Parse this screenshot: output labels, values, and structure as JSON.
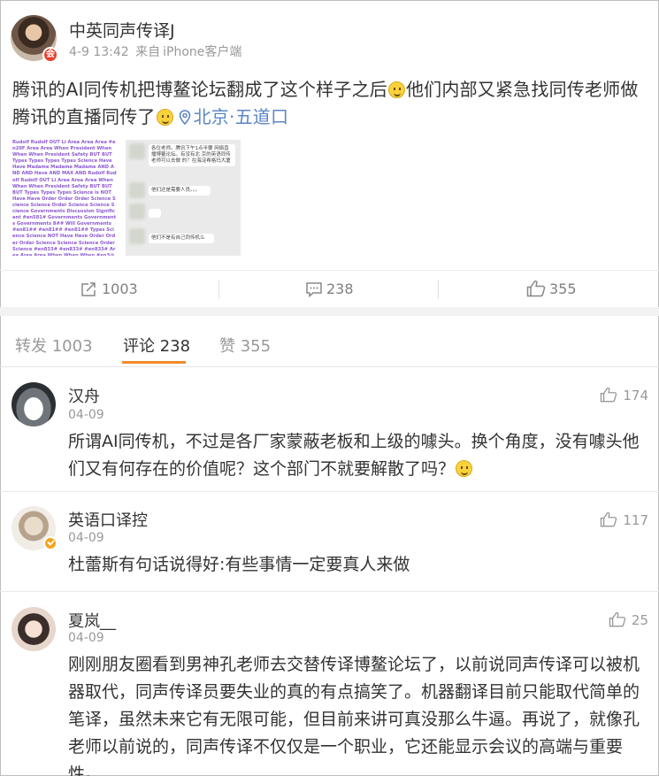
{
  "post": {
    "author": "中英同声传译J",
    "date": "4-9 13:42",
    "source_prefix": "来自",
    "source": "iPhone客户端",
    "text_part1": "腾讯的AI同传机把博鳌论坛翻成了这个样子之后",
    "text_part2": "他们内部又紧急找同传老师做腾讯的直播同传了",
    "location": "北京·五道口",
    "thumb1_text": "Rudolf Rudolf OUT Li Area Area Area #en20F Area Area When President When When When President Safety BUT BUT Types Types Types Types Science Have Have Madame Madame Madame AND AND AND Have AND MAX AND Rudolf Rudolf Rudolf OUT Li Area Area Area When When When President Safety BUT BUT BUT Types Types Types Science is NOT Have Have Order Order Order Science Science Science Order Science Science Science Governments Discussion Significant #en581# Governments Governments Governments 8## Will Governments #en81## #en81## #en81## Types Science Science NOT Have Have Order Order Order Science Science Science Order Science #en833# #en833# #en833# Area Area Area When When When #en3@@.",
    "thumb2_bubble1": "各位老师。腾讯下午1点半要 网络直播博鳌论坛。有没有北 京的英语同传老师可以去做 的？在海淀希格玛大厦",
    "thumb2_bubble2": "他们还是需要人员。。。",
    "thumb2_bubble3": "他们不是有自己同传机么"
  },
  "actions": {
    "repost_count": "1003",
    "comment_count": "238",
    "like_count": "355"
  },
  "tabs": [
    {
      "label": "转发 1003"
    },
    {
      "label": "评论 238"
    },
    {
      "label": "赞 355"
    }
  ],
  "comments": [
    {
      "name": "汉舟",
      "date": "04-09",
      "likes": "174",
      "text": "所谓AI同传机，不过是各厂家蒙蔽老板和上级的噱头。换个角度，没有噱头他们又有何存在的价值呢？这个部门不就要解散了吗？"
    },
    {
      "name": "英语口译控",
      "date": "04-09",
      "likes": "117",
      "text": "杜蕾斯有句话说得好:有些事情一定要真人来做"
    },
    {
      "name": "夏岚__",
      "date": "04-09",
      "likes": "25",
      "text": "刚刚朋友圈看到男神孔老师去交替传译博鳌论坛了，以前说同声传译可以被机器取代，同声传译员要失业的真的有点搞笑了。机器翻译目前只能取代简单的笔译，虽然未来它有无限可能，但目前来讲可真没那么牛逼。再说了，就像孔老师以前说的，同声传译不仅仅是一个职业，它还能显示会议的高端与重要性。"
    }
  ],
  "colors": {
    "location": "#5b86c4",
    "tab_underline": "#f38b2c",
    "badge_red": "#e8412c",
    "verified_orange": "#f4a21e"
  },
  "icons": [
    "location-pin-icon",
    "repost-icon",
    "comment-icon",
    "thumbs-up-icon",
    "smile-emoji-icon",
    "verified-badge-icon"
  ]
}
